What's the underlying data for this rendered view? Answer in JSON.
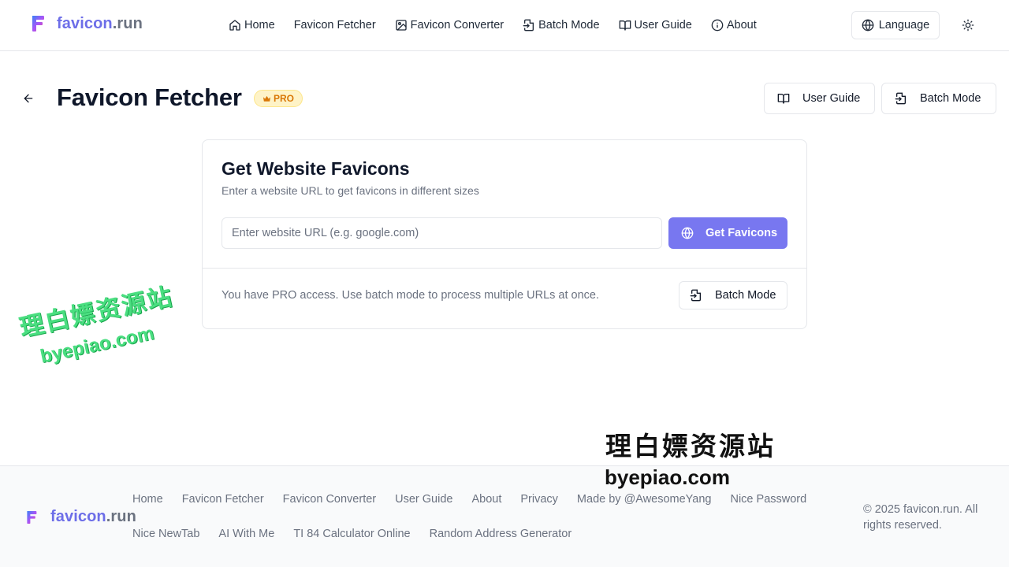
{
  "header": {
    "logo": {
      "part1": "favicon",
      "part2": ".run"
    },
    "nav": [
      {
        "label": "Home",
        "icon": "home-icon"
      },
      {
        "label": "Favicon Fetcher",
        "icon": ""
      },
      {
        "label": "Favicon Converter",
        "icon": "image-icon"
      },
      {
        "label": "Batch Mode",
        "icon": "file-import-icon"
      },
      {
        "label": "User Guide",
        "icon": "book-icon"
      },
      {
        "label": "About",
        "icon": "info-icon"
      }
    ],
    "language_label": "Language",
    "theme_icon": "sun-icon"
  },
  "page": {
    "title": "Favicon Fetcher",
    "badge": "PRO",
    "actions": {
      "user_guide": "User Guide",
      "batch_mode": "Batch Mode"
    }
  },
  "card": {
    "title": "Get Website Favicons",
    "subtitle": "Enter a website URL to get favicons in different sizes",
    "input_placeholder": "Enter website URL (e.g. google.com)",
    "input_value": "",
    "submit_label": "Get Favicons",
    "note": "You have PRO access. Use batch mode to process multiple URLs at once.",
    "batch_label": "Batch Mode"
  },
  "watermark": {
    "cn": "理白嫖资源站",
    "en": "byepiao.com"
  },
  "footer": {
    "logo": {
      "part1": "favicon",
      "part2": ".run"
    },
    "links_row1": [
      "Home",
      "Favicon Fetcher",
      "Favicon Converter",
      "User Guide",
      "About",
      "Privacy",
      "Made by @AwesomeYang",
      "Nice Password"
    ],
    "links_row2": [
      "Nice NewTab",
      "AI With Me",
      "TI 84 Calculator Online",
      "Random Address Generator"
    ],
    "copyright": "© 2025 favicon.run. All rights reserved."
  },
  "colors": {
    "brand": "#6d6ee8",
    "primary_button": "#7877f0",
    "pro_badge_bg": "#fef3c7",
    "pro_badge_text": "#d97706",
    "watermark_green": "#4ade80"
  }
}
